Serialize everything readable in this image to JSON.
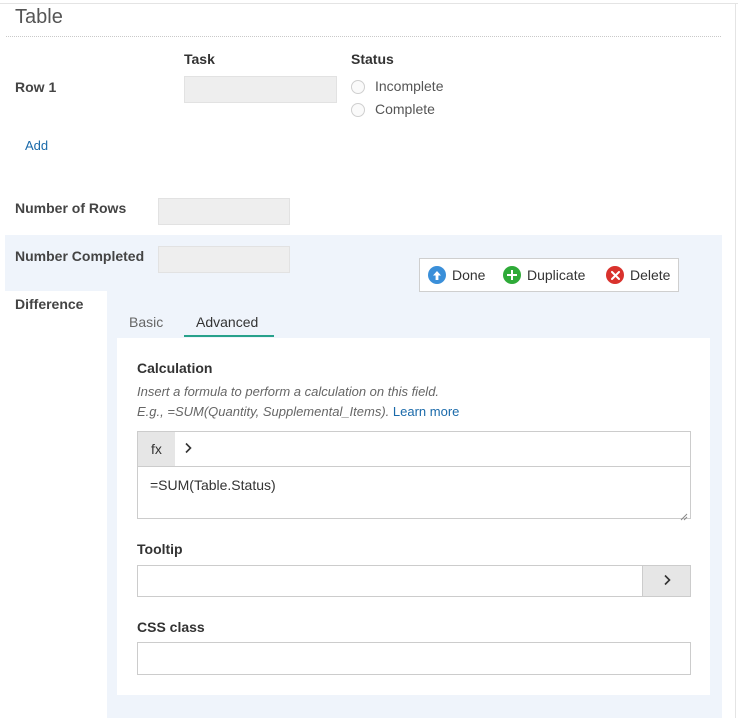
{
  "page": {
    "title": "Table"
  },
  "table": {
    "headers": {
      "task": "Task",
      "status": "Status"
    },
    "row_label": "Row 1",
    "status_options": [
      "Incomplete",
      "Complete"
    ],
    "add_label": "Add"
  },
  "fields": {
    "rows_label": "Number of Rows",
    "completed_label": "Number Completed",
    "difference_label": "Difference"
  },
  "toolbar": {
    "done_label": "Done",
    "duplicate_label": "Duplicate",
    "delete_label": "Delete"
  },
  "tabs": {
    "basic": "Basic",
    "advanced": "Advanced",
    "active": "Advanced"
  },
  "calculation": {
    "title": "Calculation",
    "help_line1": "Insert a formula to perform a calculation on this field.",
    "help_line2": "E.g., =SUM(Quantity, Supplemental_Items).",
    "learn_more": "Learn more",
    "fx_label": "fx",
    "formula": "=SUM(Table.Status)"
  },
  "tooltip": {
    "title": "Tooltip",
    "value": ""
  },
  "css_class": {
    "title": "CSS class",
    "value": ""
  },
  "colors": {
    "accent": "#27a18b",
    "link": "#1a6aaa",
    "done_icon": "#3a8fd9",
    "duplicate_icon": "#2eaa38",
    "delete_icon": "#d9322d",
    "panel_bg": "#eff4fb"
  },
  "icons": {
    "done": "arrow-up-circle-icon",
    "duplicate": "plus-circle-icon",
    "delete": "x-circle-icon"
  }
}
